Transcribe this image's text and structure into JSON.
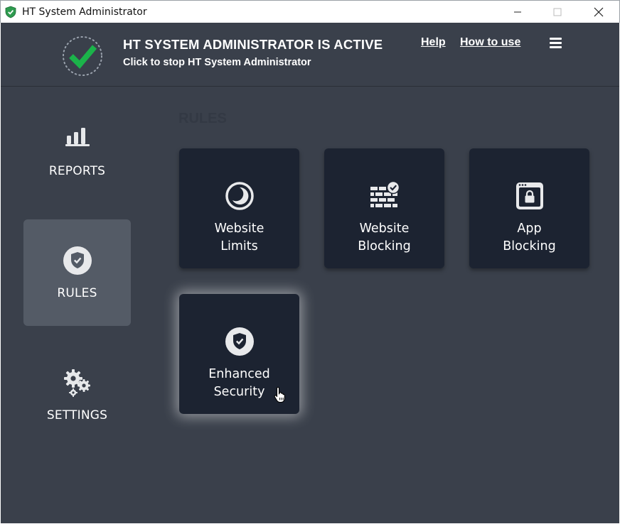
{
  "window": {
    "title": "HT System Administrator",
    "controls": [
      "minimize-icon",
      "maximize-icon",
      "close-icon"
    ]
  },
  "header": {
    "status_title": "HT SYSTEM ADMINISTRATOR IS ACTIVE",
    "status_subtitle": "Click to stop HT System Administrator",
    "status_icon": "check-icon",
    "help_label": "Help",
    "how_to_use_label": "How to use",
    "menu_icon": "hamburger-menu-icon"
  },
  "sidebar": {
    "items": [
      {
        "id": "reports",
        "label": "REPORTS",
        "icon": "bar-chart-icon",
        "active": false
      },
      {
        "id": "rules",
        "label": "RULES",
        "icon": "shield-check-icon",
        "active": true
      },
      {
        "id": "settings",
        "label": "SETTINGS",
        "icon": "gears-icon",
        "active": false
      }
    ]
  },
  "main": {
    "heading": "RULES",
    "tiles": [
      {
        "id": "website-limits",
        "line1": "Website",
        "line2": "Limits",
        "icon": "clock-icon"
      },
      {
        "id": "website-blocking",
        "line1": "Website",
        "line2": "Blocking",
        "icon": "firewall-check-icon"
      },
      {
        "id": "app-blocking",
        "line1": "App",
        "line2": "Blocking",
        "icon": "app-lock-icon"
      },
      {
        "id": "enhanced-security",
        "line1": "Enhanced",
        "line2": "Security",
        "icon": "shield-check-icon",
        "hovered": true
      }
    ]
  },
  "colors": {
    "background": "#3a404b",
    "tile": "#1c2331",
    "active_nav": "#545b66",
    "accent_green": "#1bb34a",
    "window_icon_green": "#2e9b4f"
  }
}
